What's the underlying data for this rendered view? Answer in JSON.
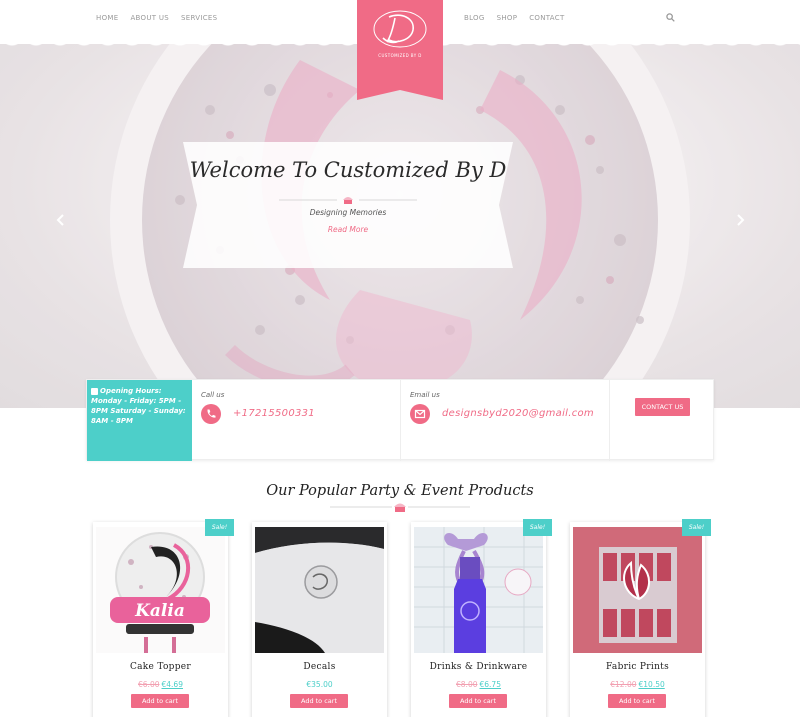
{
  "nav": {
    "left": [
      "HOME",
      "ABOUT US",
      "SERVICES"
    ],
    "right": [
      "BLOG",
      "SHOP",
      "CONTACT"
    ],
    "logo_text": "CUSTOMIZED BY D"
  },
  "hero": {
    "title": "Welcome To Customized By D",
    "subtitle": "Designing Memories",
    "read_more": "Read More"
  },
  "info": {
    "hours_title": "Opening Hours:",
    "hours_text": "Monday - Friday: 5PM - 8PM Saturday - Sunday: 8AM - 8PM",
    "call_label": "Call us",
    "phone": "+17215500331",
    "email_label": "Email us",
    "email": "designsbyd2020@gmail.com",
    "contact_button": "CONTACT US"
  },
  "products": {
    "title": "Our Popular Party & Event Products",
    "items": [
      {
        "name": "Cake Topper",
        "old_price": "€6.00",
        "price": "€4.69",
        "sale": "Sale!",
        "cart": "Add to cart"
      },
      {
        "name": "Decals",
        "old_price": "",
        "price": "€35.00",
        "sale": "",
        "cart": "Add to cart"
      },
      {
        "name": "Drinks & Drinkware",
        "old_price": "€8.00",
        "price": "€6.75",
        "sale": "Sale!",
        "cart": "Add to cart"
      },
      {
        "name": "Fabric Prints",
        "old_price": "€12.00",
        "price": "€10.50",
        "sale": "Sale!",
        "cart": "Add to cart"
      }
    ]
  },
  "colors": {
    "accent": "#f06b86",
    "teal": "#4dcfc9"
  }
}
